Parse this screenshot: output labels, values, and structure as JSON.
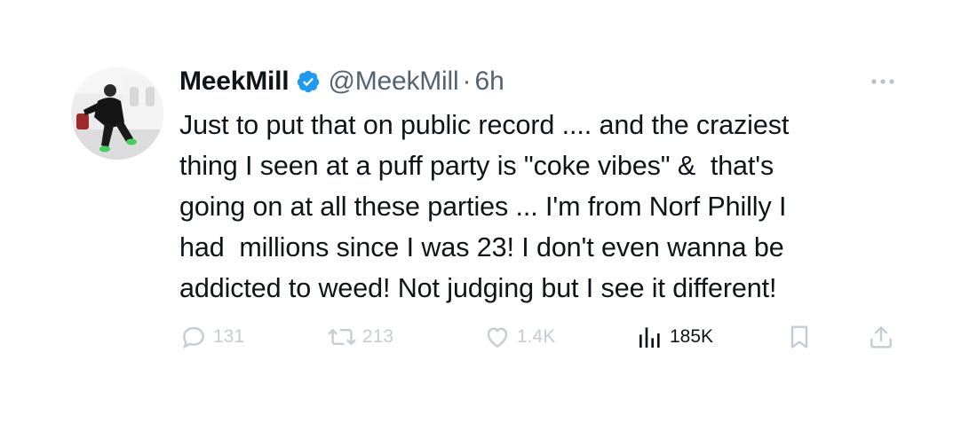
{
  "tweet": {
    "display_name": "MeekMill",
    "handle": "@MeekMill",
    "separator": "·",
    "time": "6h",
    "body": "Just to put that on public record .... and the craziest\nthing I seen at a puff party is \"coke vibes\" &  that's\ngoing on at all these parties ... I'm from Norf Philly I\nhad  millions since I was 23! I don't even wanna be\naddicted to weed! Not judging but I see it different!"
  },
  "actions": {
    "replies": "131",
    "retweets": "213",
    "likes": "1.4K",
    "views": "185K"
  },
  "icons": {
    "verified": "verified-badge-icon",
    "more": "more-dots-icon",
    "reply": "reply-icon",
    "retweet": "retweet-icon",
    "like": "heart-icon",
    "views": "analytics-bars-icon",
    "bookmark": "bookmark-icon",
    "share": "share-icon"
  },
  "colors": {
    "text": "#0f1419",
    "secondary": "#536471",
    "faded": "#c5ccd3",
    "verified": "#1d9bf0"
  }
}
